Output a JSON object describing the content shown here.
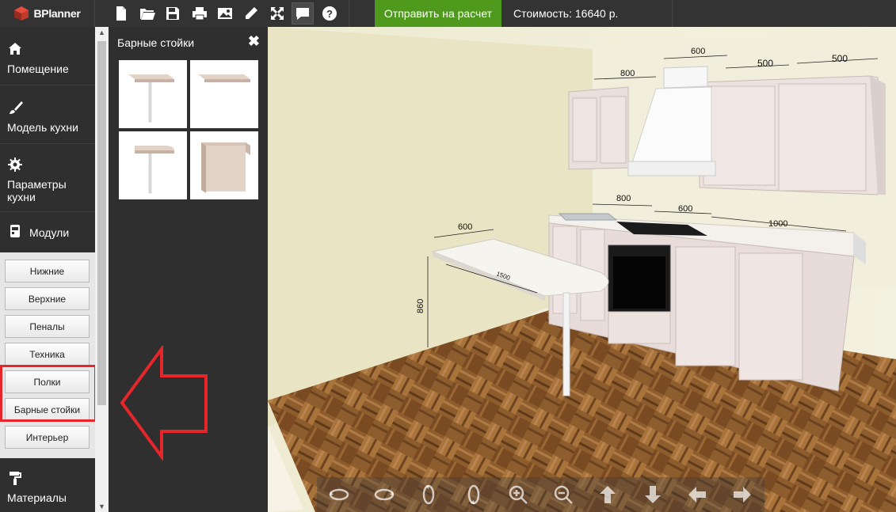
{
  "app": {
    "logo_text": "BPlanner",
    "send_label": "Отправить на расчет",
    "cost_text": "Стоимость: 16640 р.",
    "toolbar_icons": [
      "new-file-icon",
      "open-folder-icon",
      "save-icon",
      "print-icon",
      "image-icon",
      "pencil-icon",
      "fullscreen-icon",
      "chat-icon",
      "help-icon"
    ]
  },
  "sidebar": {
    "items": [
      {
        "label": "Помещение",
        "icon": "home-icon"
      },
      {
        "label": "Модель кухни",
        "icon": "brush-icon"
      },
      {
        "label": "Параметры кухни",
        "icon": "gear-icon"
      },
      {
        "label": "Модули",
        "icon": "modules-icon"
      },
      {
        "label": "Материалы",
        "icon": "paint-roller-icon"
      }
    ],
    "modules": [
      "Нижние",
      "Верхние",
      "Пеналы",
      "Техника",
      "Полки",
      "Барные стойки",
      "Интерьер"
    ],
    "highlighted": [
      "Полки",
      "Барные стойки"
    ]
  },
  "panel": {
    "title": "Барные стойки",
    "close_label": "✖",
    "thumbnails": [
      "bar-counter-leg-1",
      "bar-counter-top",
      "bar-counter-leg-2",
      "bar-counter-panel-end"
    ]
  },
  "scene": {
    "dimensions": {
      "upper_600": "600",
      "upper_800": "800",
      "upper_500_a": "500",
      "upper_500_b": "500",
      "lower_800": "800",
      "lower_600": "600",
      "lower_1000": "1000",
      "bar_600": "600",
      "bar_1500": "1500",
      "bar_860": "860"
    },
    "colors": {
      "wall": "#efecd2",
      "floor": "#8a5a2b",
      "accent_red": "#e5262b",
      "send_green": "#4f9a1c"
    }
  },
  "view_controls": [
    "rotate-left-icon",
    "rotate-right-icon",
    "rotate-up-icon",
    "rotate-down-icon",
    "zoom-in-icon",
    "zoom-out-icon",
    "pan-up-icon",
    "pan-down-icon",
    "pan-left-icon",
    "pan-right-icon"
  ]
}
